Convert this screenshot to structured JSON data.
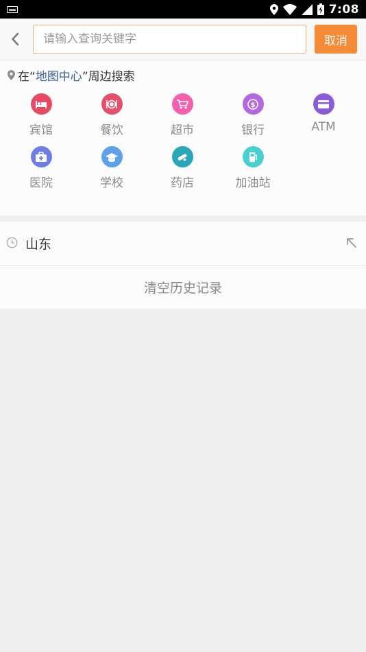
{
  "status_bar": {
    "time": "7:08",
    "battery_label": "ϟ"
  },
  "search": {
    "placeholder": "请输入查询关键字",
    "value": "",
    "cancel_label": "取消"
  },
  "nearby": {
    "title_prefix": "在“",
    "title_highlight": "地图中心",
    "title_suffix": "”周边搜索",
    "categories": [
      {
        "label": "宾馆",
        "icon": "hotel-bed-icon",
        "color": "#e84a63"
      },
      {
        "label": "餐饮",
        "icon": "dining-plate-icon",
        "color": "#e54f6a"
      },
      {
        "label": "超市",
        "icon": "shopping-cart-icon",
        "color": "#f45fb0"
      },
      {
        "label": "银行",
        "icon": "dollar-coin-icon",
        "color": "#b468e0"
      },
      {
        "label": "ATM",
        "icon": "bank-card-icon",
        "color": "#8a5cdc"
      },
      {
        "label": "医院",
        "icon": "medical-kit-icon",
        "color": "#6f7de6"
      },
      {
        "label": "学校",
        "icon": "graduation-cap-icon",
        "color": "#5fa0ea"
      },
      {
        "label": "药店",
        "icon": "pill-icon",
        "color": "#2aa7b6"
      },
      {
        "label": "加油站",
        "icon": "gas-pump-icon",
        "color": "#49cfcf"
      }
    ]
  },
  "history": {
    "items": [
      {
        "text": "山东"
      }
    ],
    "clear_label": "清空历史记录"
  }
}
